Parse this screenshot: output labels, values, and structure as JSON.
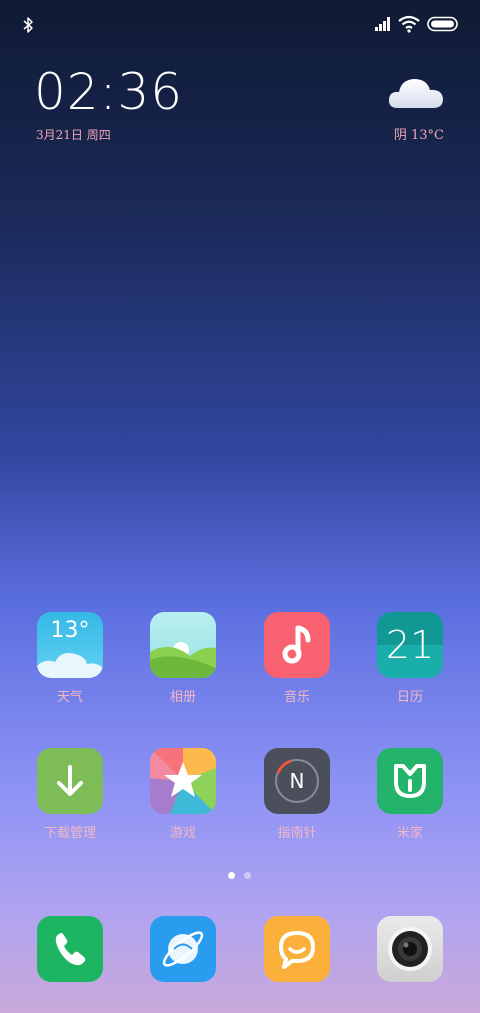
{
  "status": {
    "icons": [
      "bluetooth-icon",
      "signal-icon",
      "wifi-icon",
      "battery-icon"
    ]
  },
  "lockwidget": {
    "time": "02:36",
    "date": "3月21日 周四",
    "weather_icon": "cloud-icon",
    "weather": "阴 13°C"
  },
  "apps": [
    {
      "label": "天气",
      "icon": "weather-icon",
      "text": "13°"
    },
    {
      "label": "相册",
      "icon": "gallery-icon"
    },
    {
      "label": "音乐",
      "icon": "music-note-icon"
    },
    {
      "label": "日历",
      "icon": "calendar-icon",
      "text": "21"
    },
    {
      "label": "下载管理",
      "icon": "download-arrow-icon"
    },
    {
      "label": "游戏",
      "icon": "game-star-icon"
    },
    {
      "label": "指南针",
      "icon": "compass-icon",
      "text": "N"
    },
    {
      "label": "米家",
      "icon": "mijia-icon"
    }
  ],
  "pager": {
    "pages": 2,
    "active": 0
  },
  "dock": [
    {
      "icon": "phone-icon"
    },
    {
      "icon": "browser-icon"
    },
    {
      "icon": "messages-icon"
    },
    {
      "icon": "camera-icon"
    }
  ],
  "colors": {
    "date_text": "#f2a5b5",
    "label_text": "#f3b7c5",
    "weather": "#3ec1e8",
    "music": "#f86170",
    "calendar": "#16a2a0",
    "download": "#7ebc58",
    "compass": "#4b4f5b",
    "mijia": "#23b36a",
    "phone": "#1db562",
    "browser": "#2a9cf0",
    "messages": "#fbb03b",
    "camera": "#d9d9d9"
  }
}
